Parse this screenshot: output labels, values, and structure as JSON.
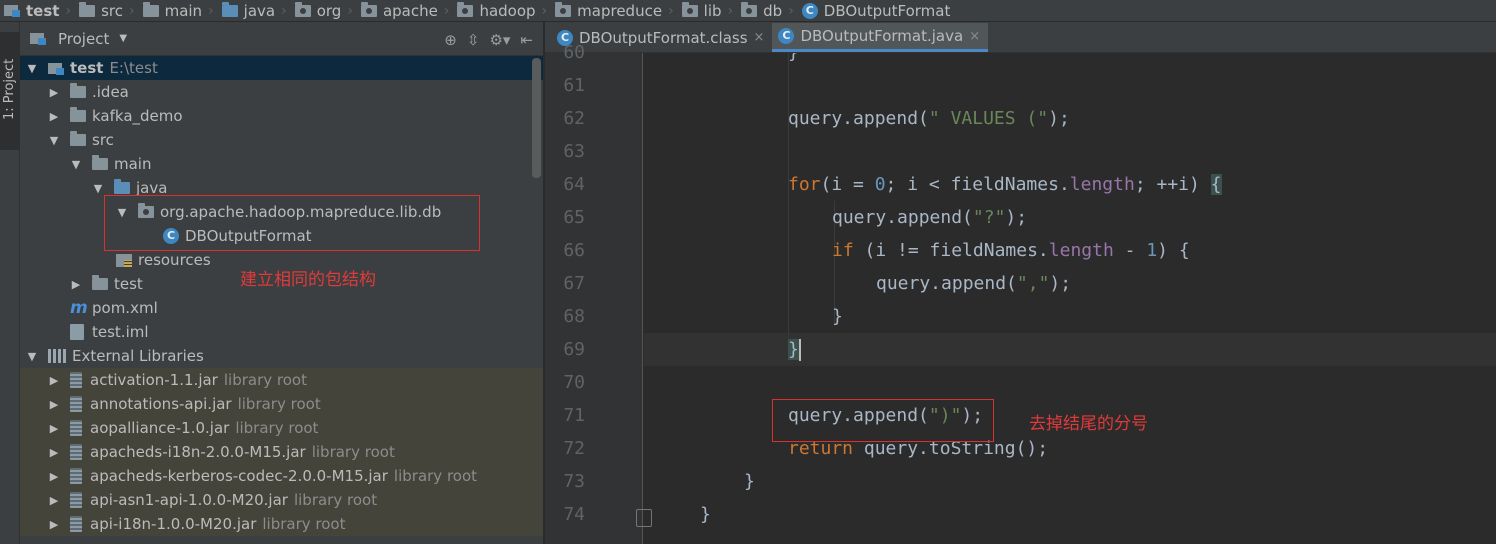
{
  "breadcrumb": {
    "items": [
      "test",
      "src",
      "main",
      "java",
      "org",
      "apache",
      "hadoop",
      "mapreduce",
      "lib",
      "db",
      "DBOutputFormat"
    ]
  },
  "side_strip": {
    "label": "1: Project"
  },
  "project_panel": {
    "title": "Project",
    "tree": {
      "root_name": "test",
      "root_path": "E:\\test",
      "idea": ".idea",
      "kafka_demo": "kafka_demo",
      "src": "src",
      "main": "main",
      "java": "java",
      "package": "org.apache.hadoop.mapreduce.lib.db",
      "class": "DBOutputFormat",
      "resources": "resources",
      "test": "test",
      "pom": "pom.xml",
      "iml": "test.iml",
      "external_libraries": "External Libraries",
      "libraries": [
        {
          "name": "activation-1.1.jar",
          "tag": "library root"
        },
        {
          "name": "annotations-api.jar",
          "tag": "library root"
        },
        {
          "name": "aopalliance-1.0.jar",
          "tag": "library root"
        },
        {
          "name": "apacheds-i18n-2.0.0-M15.jar",
          "tag": "library root"
        },
        {
          "name": "apacheds-kerberos-codec-2.0.0-M15.jar",
          "tag": "library root"
        },
        {
          "name": "api-asn1-api-1.0.0-M20.jar",
          "tag": "library root"
        },
        {
          "name": "api-i18n-1.0.0-M20.jar",
          "tag": "library root"
        }
      ]
    },
    "annotation": "建立相同的包结构"
  },
  "editor": {
    "tabs": [
      {
        "label": "DBOutputFormat.class",
        "active": false
      },
      {
        "label": "DBOutputFormat.java",
        "active": true
      }
    ],
    "line_numbers": [
      "60",
      "61",
      "62",
      "63",
      "64",
      "65",
      "66",
      "67",
      "68",
      "69",
      "70",
      "71",
      "72",
      "73",
      "74"
    ],
    "code": {
      "l60": "}",
      "l62_a": "query.append(",
      "l62_s": "\" VALUES (\"",
      "l62_b": ");",
      "l64_kw": "for",
      "l64_a": "(i = ",
      "l64_n0": "0",
      "l64_b": "; i < fieldNames.",
      "l64_f": "length",
      "l64_c": "; ++i) ",
      "l64_brace": "{",
      "l65_a": "query.append(",
      "l65_s": "\"?\"",
      "l65_b": ");",
      "l66_kw": "if",
      "l66_a": " (i != fieldNames.",
      "l66_f": "length",
      "l66_b": " - ",
      "l66_n1": "1",
      "l66_c": ") {",
      "l67_a": "query.append(",
      "l67_s": "\",\"",
      "l67_b": ");",
      "l68": "}",
      "l69": "}",
      "l71_a": "query.append(",
      "l71_s": "\")\"",
      "l71_b": ");",
      "l72_kw": "return",
      "l72_a": " query.toString();",
      "l73": "}",
      "l74": "}"
    },
    "annotation": "去掉结尾的分号"
  },
  "colors": {
    "keyword": "#cc7832",
    "string": "#6a8759",
    "number": "#6897bb",
    "field": "#9876aa",
    "annotation_red": "#e03a3a"
  }
}
